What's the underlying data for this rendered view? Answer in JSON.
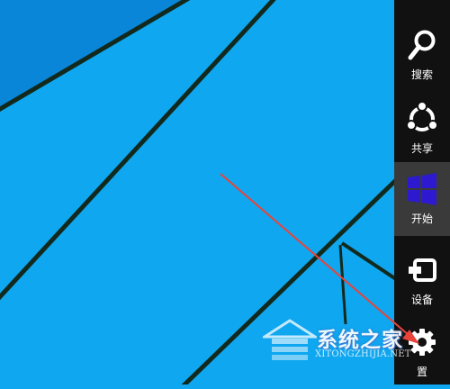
{
  "charms": [
    {
      "id": "search",
      "label": "搜索",
      "icon": "search-icon"
    },
    {
      "id": "share",
      "label": "共享",
      "icon": "share-icon"
    },
    {
      "id": "start",
      "label": "开始",
      "icon": "windows-logo-icon",
      "accent": "#2d1ad0"
    },
    {
      "id": "devices",
      "label": "设备",
      "icon": "devices-icon"
    },
    {
      "id": "settings",
      "label": "置",
      "icon": "gear-icon"
    }
  ],
  "watermark": {
    "title": "系统之家",
    "url": "XITONGZHIJIA.NET"
  },
  "colors": {
    "desktop": "#0fa7f0",
    "charms_bar": "#111111",
    "active_charm": "#3a3a3a",
    "arrow": "#e8443a"
  }
}
